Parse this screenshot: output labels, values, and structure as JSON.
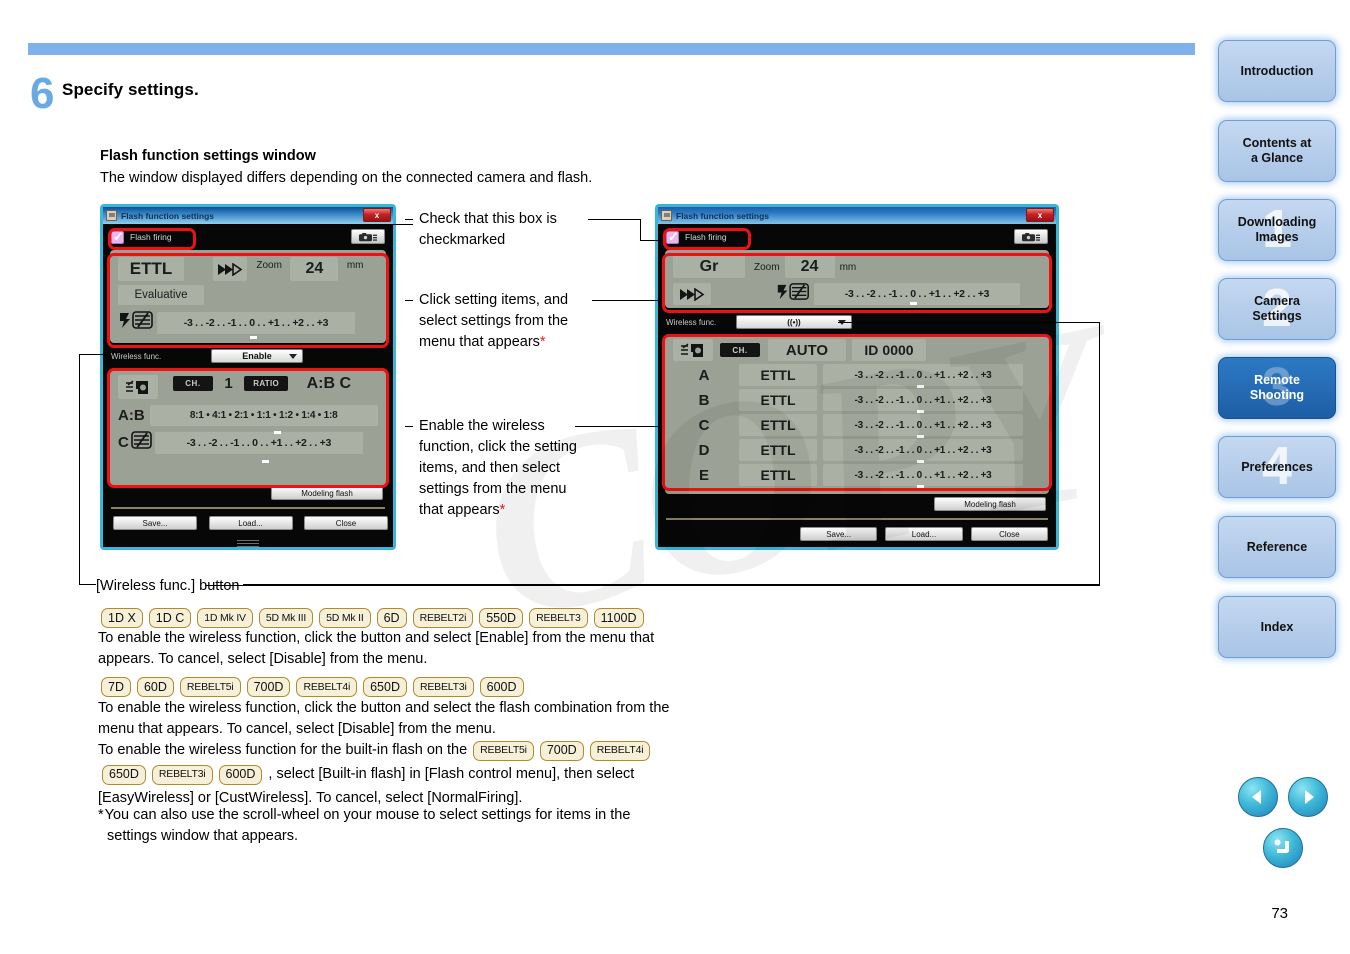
{
  "page": {
    "number": "73",
    "step_number": "6",
    "step_title": "Specify settings.",
    "section_heading": "Flash function settings window",
    "section_sub": "The window displayed differs depending on the connected camera and flash."
  },
  "callouts": {
    "checkbox": "Check that this box is\ncheckmarked",
    "setting_items": "Click setting items, and\nselect settings from the\nmenu that appears",
    "wireless": "Enable the wireless\nfunction, click the setting\nitems, and then select\nsettings from the menu\nthat appears",
    "asterisk": "*",
    "wireless_button_label": "[Wireless func.] button"
  },
  "dialog_left": {
    "title": "Flash function settings",
    "close_label": "x",
    "flash_firing": "Flash firing",
    "mode": "ETTL",
    "metering": "Evaluative",
    "zoom_label": "Zoom",
    "zoom_value": "24",
    "zoom_unit": "mm",
    "exp_scale": "-3 . . -2 . . -1 . . 0 . . +1 . . +2 . . +3",
    "wireless_label": "Wireless func.",
    "wireless_value": "Enable",
    "ch_label": "CH.",
    "ch_value": "1",
    "ratio_label": "RATIO",
    "groups": "A:B C",
    "ab_label": "A:B",
    "ab_scale": "8:1 • 4:1 • 2:1 • 1:1 • 1:2 • 1:4 • 1:8",
    "c_label": "C",
    "c_scale": "-3 . . -2 . . -1 . . 0 . . +1 . . +2 . . +3",
    "modeling_flash": "Modeling flash",
    "save": "Save...",
    "load": "Load...",
    "close": "Close"
  },
  "dialog_right": {
    "title": "Flash function settings",
    "close_label": "x",
    "flash_firing": "Flash firing",
    "mode": "Gr",
    "zoom_label": "Zoom",
    "zoom_value": "24",
    "zoom_unit": "mm",
    "exp_scale": "-3 . . -2 . . -1 . . 0 . . +1 . . +2 . . +3",
    "wireless_label": "Wireless func.",
    "wireless_value": "((•))",
    "ch_label": "CH.",
    "ch_value": "AUTO",
    "id_label": "ID",
    "id_value": "0000",
    "group_rows": [
      {
        "group": "A",
        "mode": "ETTL",
        "scale": "-3 . . -2 . . -1 . . 0 . . +1 . . +2 . . +3"
      },
      {
        "group": "B",
        "mode": "ETTL",
        "scale": "-3 . . -2 . . -1 . . 0 . . +1 . . +2 . . +3"
      },
      {
        "group": "C",
        "mode": "ETTL",
        "scale": "-3 . . -2 . . -1 . . 0 . . +1 . . +2 . . +3"
      },
      {
        "group": "D",
        "mode": "ETTL",
        "scale": "-3 . . -2 . . -1 . . 0 . . +1 . . +2 . . +3"
      },
      {
        "group": "E",
        "mode": "ETTL",
        "scale": "-3 . . -2 . . -1 . . 0 . . +1 . . +2 . . +3"
      }
    ],
    "modeling_flash": "Modeling flash",
    "save": "Save...",
    "load": "Load...",
    "close": "Close"
  },
  "body": {
    "row1_badges": [
      "1D X",
      "1D C",
      "1D Mk IV",
      "5D Mk III",
      "5D Mk II",
      "6D",
      "REBELT2i",
      "550D",
      "REBELT3",
      "1100D"
    ],
    "row1_text_line1": "To enable the wireless function, click the button and select [Enable] from the menu that",
    "row1_text_line2": "appears. To cancel, select [Disable] from the menu.",
    "row2_badges": [
      "7D",
      "60D",
      "REBELT5i",
      "700D",
      "REBELT4i",
      "650D",
      "REBELT3i",
      "600D"
    ],
    "row2_text_line1": "To enable the wireless function, click the button and select the flash combination from the",
    "row2_text_line2": "menu that appears. To cancel, select [Disable] from the menu.",
    "row3_prefix": "To enable the wireless function for the built-in flash on the",
    "row3_badges_a": [
      "REBELT5i",
      "700D",
      "REBELT4i"
    ],
    "row3_badges_b": [
      "650D",
      "REBELT3i",
      "600D"
    ],
    "row3_mid": ", select [Built-in flash] in [Flash control menu], then select",
    "row3_line2": "[EasyWireless] or [CustWireless]. To cancel, select [NormalFiring].",
    "footnote_mark": "*",
    "footnote_line1": "You can also use the scroll-wheel on your mouse to select settings for items in the",
    "footnote_line2": "settings window that appears."
  },
  "sidebar": {
    "items": [
      {
        "label": "Introduction",
        "ghost": "",
        "active": false
      },
      {
        "label": "Contents at\na Glance",
        "ghost": "",
        "active": false
      },
      {
        "label": "Downloading\nImages",
        "ghost": "1",
        "active": false
      },
      {
        "label": "Camera\nSettings",
        "ghost": "2",
        "active": false
      },
      {
        "label": "Remote\nShooting",
        "ghost": "3",
        "active": true
      },
      {
        "label": "Preferences",
        "ghost": "4",
        "active": false
      },
      {
        "label": "Reference",
        "ghost": "",
        "active": false
      },
      {
        "label": "Index",
        "ghost": "",
        "active": false
      }
    ]
  },
  "colors": {
    "accent": "#7fb2ec",
    "active_tab": "#2d79c4",
    "highlight_ring": "#ee1111",
    "badge_bg": "#f7f0d8",
    "badge_border": "#b08a2e"
  }
}
